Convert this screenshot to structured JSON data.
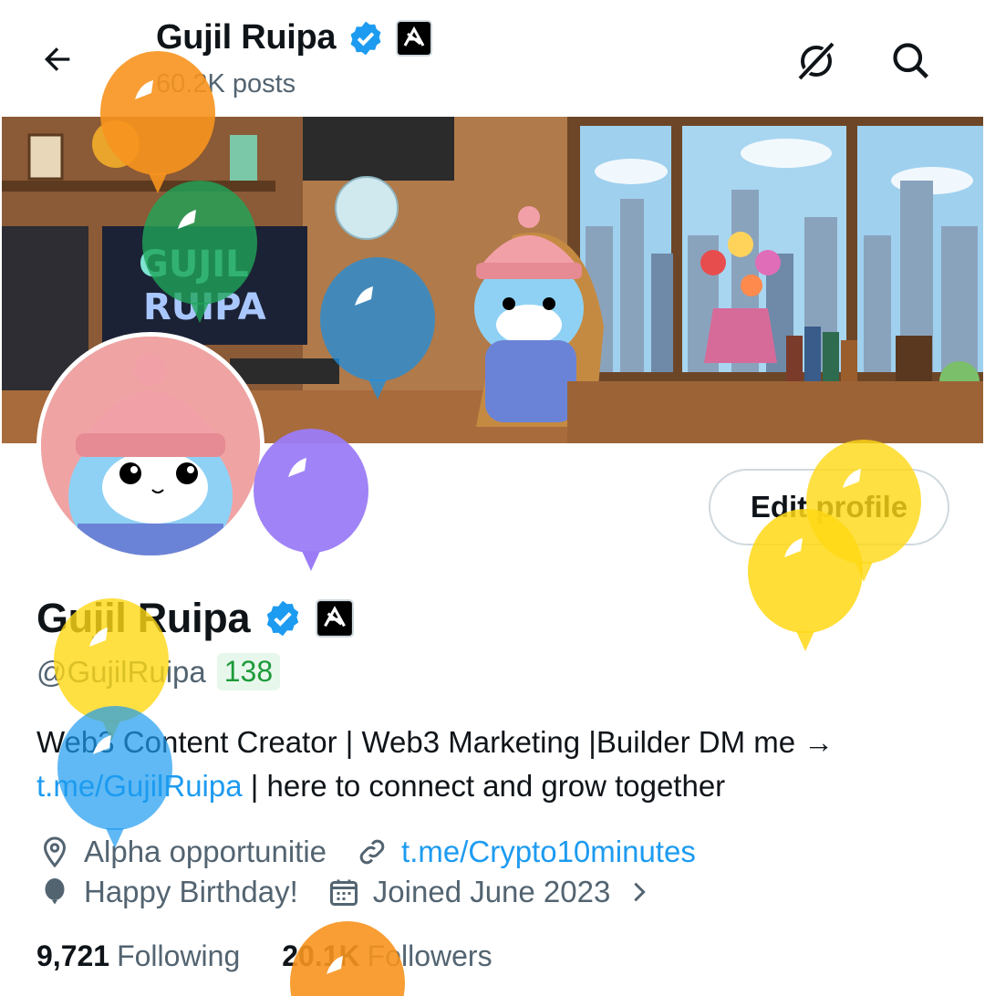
{
  "header": {
    "back_icon": "arrow-left-icon",
    "title": "Gujil Ruipa",
    "posts_count": "60.2K posts",
    "grok_icon": "grok-icon",
    "search_icon": "search-icon"
  },
  "banner": {
    "sign_text_1": "GUJIL",
    "sign_text_2": "RUIPA"
  },
  "profile": {
    "edit_label": "Edit profile",
    "display_name": "Gujil Ruipa",
    "verified_icon": "verified-badge-icon",
    "affiliate_icon": "affiliate-badge-icon",
    "handle": "@GujilRuipa",
    "score": "138",
    "bio_text": "Web3 Content Creator | Web3 Marketing |Builder  DM me →",
    "bio_link": "t.me/GujilRuipa",
    "bio_rest": " | here to connect and grow together",
    "location": "Alpha opportunitie",
    "website": "t.me/Crypto10minutes",
    "birthday": "Happy Birthday!",
    "joined": "Joined June 2023"
  },
  "stats": {
    "following_count": "9,721",
    "following_label": "Following",
    "followers_count": "20.1K",
    "followers_label": "Followers"
  },
  "colors": {
    "accent": "#1d9bf0",
    "text": "#0f1419",
    "secondary": "#536471",
    "score_green": "#1d9b3a",
    "balloon_orange": "#f7931e",
    "balloon_green": "#1fa55a",
    "balloon_blue": "#1d8fe0",
    "balloon_purple": "#9b7cf6",
    "balloon_yellow": "#ffd814"
  }
}
